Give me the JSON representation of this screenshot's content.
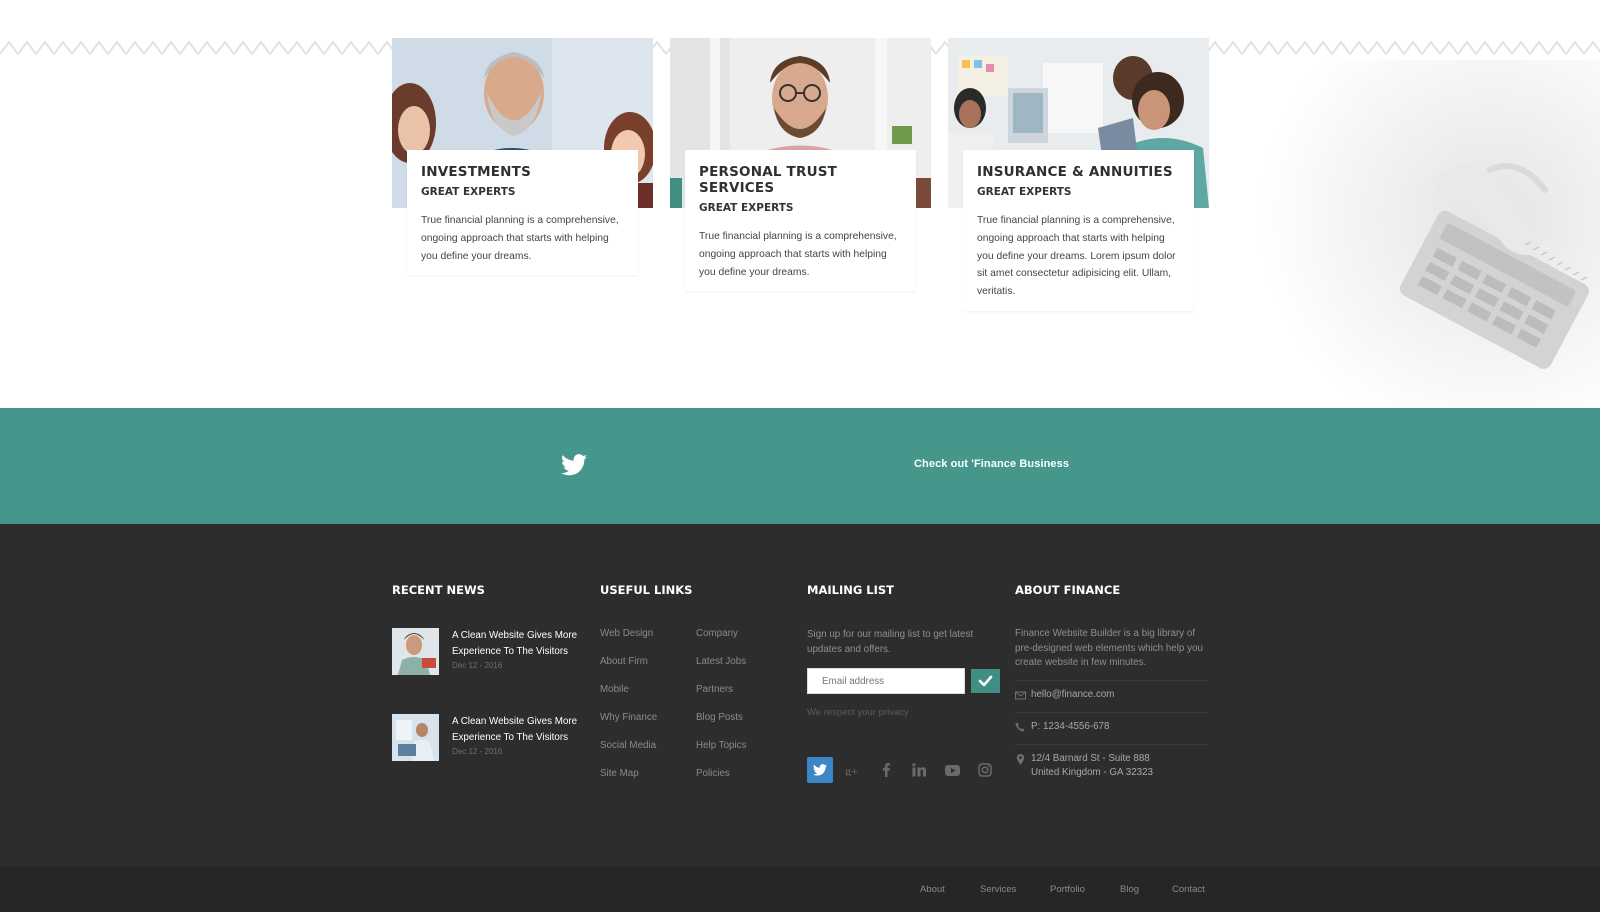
{
  "services": [
    {
      "photo": "executive-team-photo",
      "title": "INVESTMENTS",
      "subtitle": "GREAT EXPERTS",
      "text": "True financial planning is a comprehensive, ongoing approach that starts with helping you define your dreams."
    },
    {
      "photo": "consultant-working-photo",
      "title": "PERSONAL TRUST SERVICES",
      "subtitle": "GREAT EXPERTS",
      "text": "True financial planning is a comprehensive, ongoing approach that starts with helping you define your dreams."
    },
    {
      "photo": "office-team-photo",
      "title": "INSURANCE & ANNUITIES",
      "subtitle": "GREAT EXPERTS",
      "text": "True financial planning is a comprehensive, ongoing approach that starts with helping you define your dreams. Lorem ipsum dolor sit amet consectetur adipisicing elit. Ullam, veritatis."
    }
  ],
  "twitter_bar": {
    "icon": "twitter-bird-icon",
    "text": "Check out 'Finance Business"
  },
  "footer": {
    "recent_news": {
      "title": "RECENT NEWS",
      "items": [
        {
          "title": "A Clean Website Gives More Experience To The Visitors",
          "date": "Dec 12 - 2016"
        },
        {
          "title": "A Clean Website Gives More Experience To The Visitors",
          "date": "Dec 12 - 2016"
        }
      ]
    },
    "useful_links": {
      "title": "USEFUL LINKS",
      "col1": [
        "Web Design",
        "About Firm",
        "Mobile",
        "Why Finance",
        "Social Media",
        "Site Map"
      ],
      "col2": [
        "Company",
        "Latest Jobs",
        "Partners",
        "Blog Posts",
        "Help Topics",
        "Policies"
      ]
    },
    "mailing_list": {
      "title": "MAILING LIST",
      "text": "Sign up for our mailing list to get latest updates and offers.",
      "placeholder": "Email address",
      "privacy": "We respect your privacy",
      "social": [
        "twitter-icon",
        "google-plus-icon",
        "facebook-icon",
        "linkedin-icon",
        "youtube-icon",
        "instagram-icon"
      ]
    },
    "about": {
      "title": "ABOUT FINANCE",
      "text": "Finance Website Builder is a big library of pre-designed web elements which help you create website in few minutes.",
      "email": "hello@finance.com",
      "phone": "P: 1234-4556-678",
      "address_line1": "12/4 Barnard St - Suite 888",
      "address_line2": "United Kingdom - GA 32323"
    }
  },
  "bottom_nav": [
    "About",
    "Services",
    "Portfolio",
    "Blog",
    "Contact"
  ],
  "colors": {
    "accent": "#45968b",
    "footer_bg": "#2d2d2d",
    "bottom_bar_bg": "#262626",
    "twitter_blue": "#3b86c6"
  }
}
